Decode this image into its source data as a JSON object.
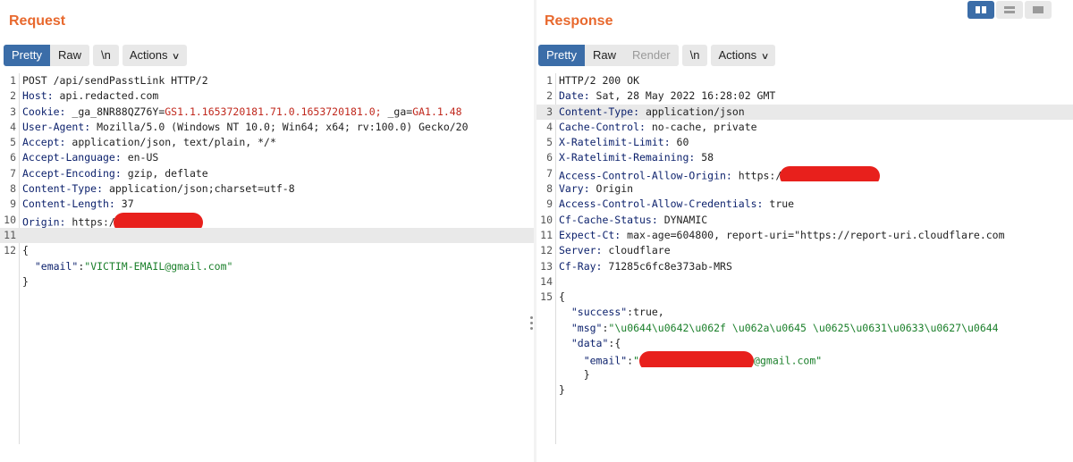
{
  "request": {
    "title": "Request",
    "tabs": [
      "Pretty",
      "Raw"
    ],
    "newline_label": "\\n",
    "actions_label": "Actions",
    "lines": [
      {
        "n": "1",
        "text": "POST /api/sendPasstLink HTTP/2"
      },
      {
        "n": "2",
        "key": "Host:",
        "val": " api.redacted.com"
      },
      {
        "n": "3",
        "key": "Cookie:",
        "val": " _ga_8NR88QZ76Y=",
        "red": "GS1.1.1653720181.71.0.1653720181.0;",
        "val2": " _ga=",
        "red2": "GA1.1.48"
      },
      {
        "n": "4",
        "key": "User-Agent:",
        "val": " Mozilla/5.0 (Windows NT 10.0; Win64; x64; rv:100.0) Gecko/20"
      },
      {
        "n": "5",
        "key": "Accept:",
        "val": " application/json, text/plain, */*"
      },
      {
        "n": "6",
        "key": "Accept-Language:",
        "val": " en-US"
      },
      {
        "n": "7",
        "key": "Accept-Encoding:",
        "val": " gzip, deflate"
      },
      {
        "n": "8",
        "key": "Content-Type:",
        "val": " application/json;charset=utf-8"
      },
      {
        "n": "9",
        "key": "Content-Length:",
        "val": " 37"
      },
      {
        "n": "10",
        "key": "Origin:",
        "val": " https:/"
      },
      {
        "n": "11",
        "text": ""
      },
      {
        "n": "12",
        "text": "{"
      },
      {
        "n": "",
        "json_key": "\"email\"",
        "json_val": "\"VICTIM-EMAIL@gmail.com\""
      },
      {
        "n": "",
        "text": "}"
      }
    ]
  },
  "response": {
    "title": "Response",
    "tabs": [
      "Pretty",
      "Raw",
      "Render"
    ],
    "newline_label": "\\n",
    "actions_label": "Actions",
    "lines": [
      {
        "n": "1",
        "text": "HTTP/2 200 OK"
      },
      {
        "n": "2",
        "key": "Date:",
        "val": " Sat, 28 May 2022 16:28:02 GMT"
      },
      {
        "n": "3",
        "key": "Content-Type:",
        "val": " application/json"
      },
      {
        "n": "4",
        "key": "Cache-Control:",
        "val": " no-cache, private"
      },
      {
        "n": "5",
        "key": "X-Ratelimit-Limit:",
        "val": " 60"
      },
      {
        "n": "6",
        "key": "X-Ratelimit-Remaining:",
        "val": " 58"
      },
      {
        "n": "7",
        "key": "Access-Control-Allow-Origin:",
        "val": " https:/"
      },
      {
        "n": "8",
        "key": "Vary:",
        "val": " Origin"
      },
      {
        "n": "9",
        "key": "Access-Control-Allow-Credentials:",
        "val": " true"
      },
      {
        "n": "10",
        "key": "Cf-Cache-Status:",
        "val": " DYNAMIC"
      },
      {
        "n": "11",
        "key": "Expect-Ct:",
        "val": " max-age=604800, report-uri=\"https://report-uri.cloudflare.com"
      },
      {
        "n": "12",
        "key": "Server:",
        "val": " cloudflare"
      },
      {
        "n": "13",
        "key": "Cf-Ray:",
        "val": " 71285c6fc8e373ab-MRS"
      },
      {
        "n": "14",
        "text": ""
      },
      {
        "n": "15",
        "text": "{"
      },
      {
        "n": "",
        "json_key": "\"success\"",
        "json_plain": "true,"
      },
      {
        "n": "",
        "json_key": "\"msg\"",
        "json_val": "\"\\u0644\\u0642\\u062f \\u062a\\u0645 \\u0625\\u0631\\u0633\\u0627\\u0644"
      },
      {
        "n": "",
        "json_key": "\"data\"",
        "json_plain": "{"
      },
      {
        "n": "",
        "indent2": true,
        "json_key": "\"email\"",
        "json_val_tail": "@gmail.com\""
      },
      {
        "n": "",
        "indent2": true,
        "text": "}"
      },
      {
        "n": "",
        "text": "}"
      }
    ]
  }
}
